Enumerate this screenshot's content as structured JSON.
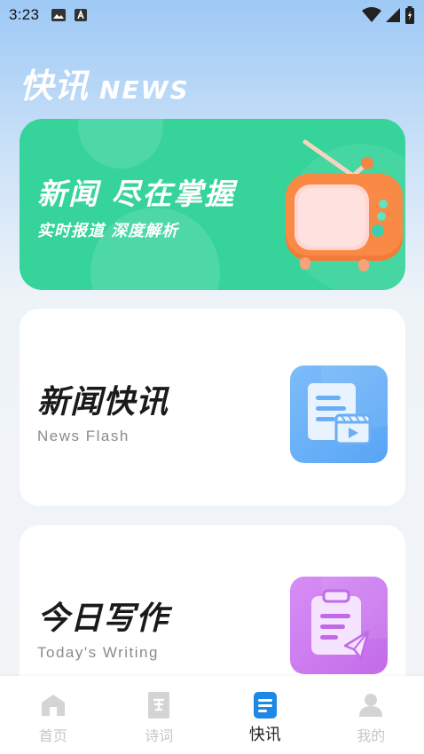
{
  "status_bar": {
    "time": "3:23",
    "icons": [
      "image-icon",
      "text-a-icon",
      "wifi-icon",
      "signal-icon",
      "battery-icon"
    ]
  },
  "header": {
    "title": "快讯",
    "subtitle": "NEWS"
  },
  "banner": {
    "title": "新闻 尽在掌握",
    "subtitle": "实时报道 深度解析",
    "icon": "tv-icon",
    "color": "#36d39b"
  },
  "cards": [
    {
      "title": "新闻快讯",
      "subtitle": "News Flash",
      "icon": "document-video-icon",
      "color": "#62aaf6"
    },
    {
      "title": "今日写作",
      "subtitle": "Today's Writing",
      "icon": "clipboard-send-icon",
      "color": "#cb78ee"
    }
  ],
  "nav": {
    "items": [
      {
        "label": "首页",
        "icon": "home-icon",
        "active": false
      },
      {
        "label": "诗词",
        "icon": "poetry-book-icon",
        "active": false
      },
      {
        "label": "快讯",
        "icon": "news-doc-icon",
        "active": true
      },
      {
        "label": "我的",
        "icon": "user-icon",
        "active": false
      }
    ],
    "active_color": "#1e88e5",
    "inactive_color": "#c7c7c7"
  }
}
